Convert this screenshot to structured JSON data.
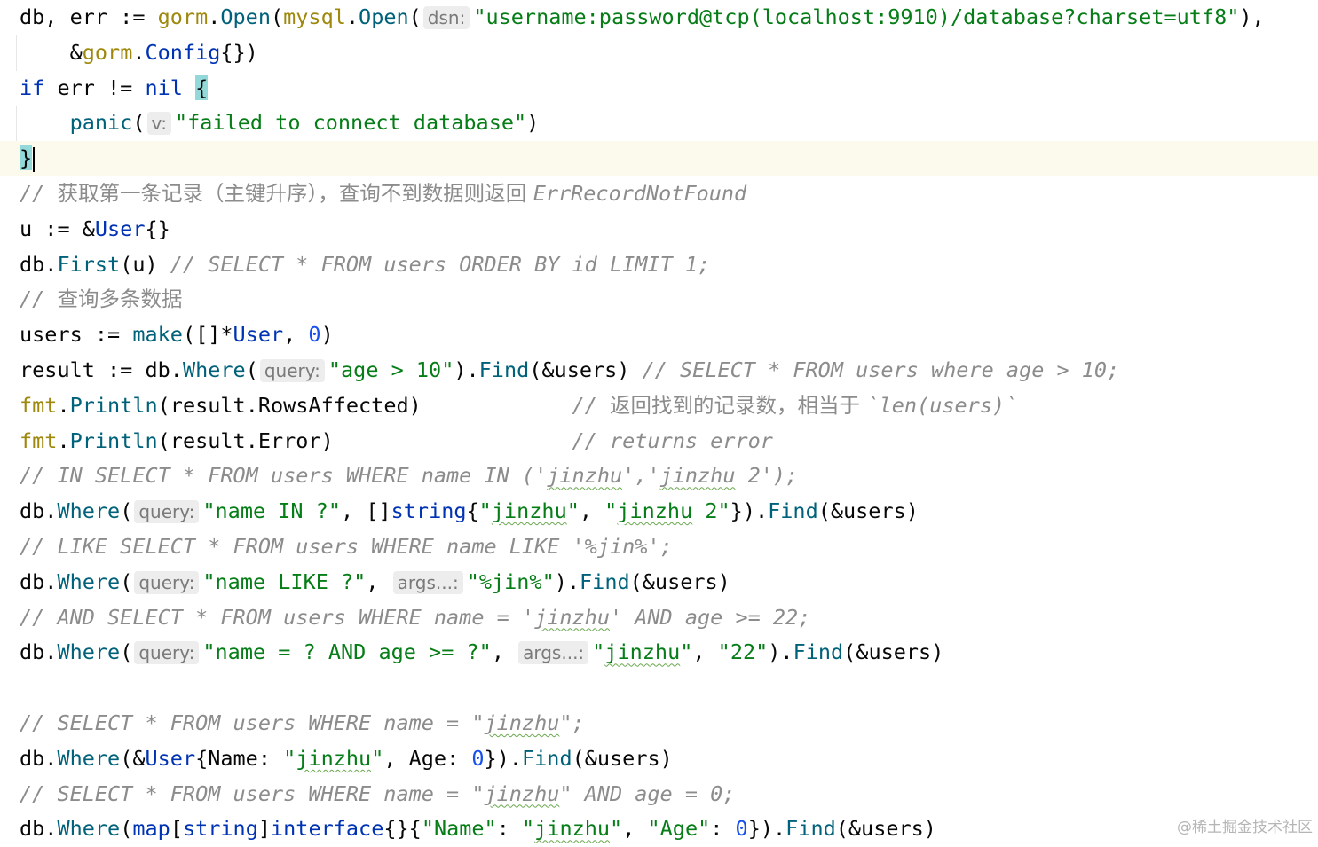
{
  "colors": {
    "background": "#ffffff",
    "current_line": "#fcfaed",
    "keyword": "#0033b3",
    "package": "#9e880d",
    "function": "#00627a",
    "string": "#067d17",
    "number": "#1750eb",
    "comment": "#8c8c8c",
    "hint_bg": "#ededed",
    "brace_highlight": "#93d9d9"
  },
  "editor": {
    "current_line_index": 4,
    "lines": [
      [
        {
          "t": "plain",
          "v": "db, err := "
        },
        {
          "t": "pkg",
          "v": "gorm"
        },
        {
          "t": "plain",
          "v": "."
        },
        {
          "t": "fn",
          "v": "Open"
        },
        {
          "t": "plain",
          "v": "("
        },
        {
          "t": "pkg",
          "v": "mysql"
        },
        {
          "t": "plain",
          "v": "."
        },
        {
          "t": "fn",
          "v": "Open"
        },
        {
          "t": "plain",
          "v": "("
        },
        {
          "t": "hint",
          "v": "dsn:"
        },
        {
          "t": "str",
          "v": "\"username:password@tcp(localhost:9910)/database?charset=utf8\""
        },
        {
          "t": "plain",
          "v": "),"
        }
      ],
      [
        {
          "t": "plain",
          "v": "    &"
        },
        {
          "t": "pkg",
          "v": "gorm"
        },
        {
          "t": "plain",
          "v": "."
        },
        {
          "t": "type",
          "v": "Config"
        },
        {
          "t": "plain",
          "v": "{})"
        }
      ],
      [
        {
          "t": "kw",
          "v": "if"
        },
        {
          "t": "plain",
          "v": " err != "
        },
        {
          "t": "kw",
          "v": "nil"
        },
        {
          "t": "plain",
          "v": " "
        },
        {
          "t": "brace",
          "v": "{"
        }
      ],
      [
        {
          "t": "plain",
          "v": "    "
        },
        {
          "t": "fn",
          "v": "panic"
        },
        {
          "t": "plain",
          "v": "("
        },
        {
          "t": "hint",
          "v": "v:"
        },
        {
          "t": "str",
          "v": "\"failed to connect database\""
        },
        {
          "t": "plain",
          "v": ")"
        }
      ],
      [
        {
          "t": "brace",
          "v": "}"
        },
        {
          "t": "caret",
          "v": ""
        }
      ],
      [
        {
          "t": "comment",
          "v": "// "
        },
        {
          "t": "comment-cn",
          "v": "获取第一条记录（主键升序），查询不到数据则返回 "
        },
        {
          "t": "comment",
          "v": "ErrRecordNotFound"
        }
      ],
      [
        {
          "t": "plain",
          "v": "u := &"
        },
        {
          "t": "type",
          "v": "User"
        },
        {
          "t": "plain",
          "v": "{}"
        }
      ],
      [
        {
          "t": "plain",
          "v": "db."
        },
        {
          "t": "fn",
          "v": "First"
        },
        {
          "t": "plain",
          "v": "(u) "
        },
        {
          "t": "comment",
          "v": "// SELECT * FROM users ORDER BY id LIMIT 1;"
        }
      ],
      [
        {
          "t": "comment",
          "v": "// "
        },
        {
          "t": "comment-cn",
          "v": "查询多条数据"
        }
      ],
      [
        {
          "t": "plain",
          "v": "users := "
        },
        {
          "t": "fn",
          "v": "make"
        },
        {
          "t": "plain",
          "v": "([]*"
        },
        {
          "t": "type",
          "v": "User"
        },
        {
          "t": "plain",
          "v": ", "
        },
        {
          "t": "num",
          "v": "0"
        },
        {
          "t": "plain",
          "v": ")"
        }
      ],
      [
        {
          "t": "plain",
          "v": "result := db."
        },
        {
          "t": "fn",
          "v": "Where"
        },
        {
          "t": "plain",
          "v": "("
        },
        {
          "t": "hint",
          "v": "query:"
        },
        {
          "t": "str",
          "v": "\"age > 10\""
        },
        {
          "t": "plain",
          "v": ")."
        },
        {
          "t": "fn",
          "v": "Find"
        },
        {
          "t": "plain",
          "v": "(&users) "
        },
        {
          "t": "comment",
          "v": "// SELECT * FROM users where age > 10;"
        }
      ],
      [
        {
          "t": "pkg",
          "v": "fmt"
        },
        {
          "t": "plain",
          "v": "."
        },
        {
          "t": "fn",
          "v": "Println"
        },
        {
          "t": "plain",
          "v": "(result.RowsAffected)            "
        },
        {
          "t": "comment",
          "v": "// "
        },
        {
          "t": "comment-cn",
          "v": "返回找到的记录数，相当于 "
        },
        {
          "t": "comment",
          "v": "`len(users)`"
        }
      ],
      [
        {
          "t": "pkg",
          "v": "fmt"
        },
        {
          "t": "plain",
          "v": "."
        },
        {
          "t": "fn",
          "v": "Println"
        },
        {
          "t": "plain",
          "v": "(result.Error)                   "
        },
        {
          "t": "comment",
          "v": "// returns error"
        }
      ],
      [
        {
          "t": "comment",
          "v": "// IN SELECT * FROM users WHERE name IN ('"
        },
        {
          "t": "comment-sq",
          "v": "jinzhu"
        },
        {
          "t": "comment",
          "v": "','"
        },
        {
          "t": "comment-sq",
          "v": "jinzhu"
        },
        {
          "t": "comment",
          "v": " 2');"
        }
      ],
      [
        {
          "t": "plain",
          "v": "db."
        },
        {
          "t": "fn",
          "v": "Where"
        },
        {
          "t": "plain",
          "v": "("
        },
        {
          "t": "hint",
          "v": "query:"
        },
        {
          "t": "str",
          "v": "\"name IN ?\""
        },
        {
          "t": "plain",
          "v": ", []"
        },
        {
          "t": "kw",
          "v": "string"
        },
        {
          "t": "plain",
          "v": "{"
        },
        {
          "t": "str",
          "v": "\""
        },
        {
          "t": "str-sq",
          "v": "jinzhu"
        },
        {
          "t": "str",
          "v": "\""
        },
        {
          "t": "plain",
          "v": ", "
        },
        {
          "t": "str",
          "v": "\""
        },
        {
          "t": "str-sq",
          "v": "jinzhu"
        },
        {
          "t": "str",
          "v": " 2\""
        },
        {
          "t": "plain",
          "v": "})."
        },
        {
          "t": "fn",
          "v": "Find"
        },
        {
          "t": "plain",
          "v": "(&users)"
        }
      ],
      [
        {
          "t": "comment",
          "v": "// LIKE SELECT * FROM users WHERE name LIKE '%jin%';"
        }
      ],
      [
        {
          "t": "plain",
          "v": "db."
        },
        {
          "t": "fn",
          "v": "Where"
        },
        {
          "t": "plain",
          "v": "("
        },
        {
          "t": "hint",
          "v": "query:"
        },
        {
          "t": "str",
          "v": "\"name LIKE ?\""
        },
        {
          "t": "plain",
          "v": ", "
        },
        {
          "t": "hint",
          "v": "args...:"
        },
        {
          "t": "str",
          "v": "\"%jin%\""
        },
        {
          "t": "plain",
          "v": ")."
        },
        {
          "t": "fn",
          "v": "Find"
        },
        {
          "t": "plain",
          "v": "(&users)"
        }
      ],
      [
        {
          "t": "comment",
          "v": "// AND SELECT * FROM users WHERE name = '"
        },
        {
          "t": "comment-sq",
          "v": "jinzhu"
        },
        {
          "t": "comment",
          "v": "' AND age >= 22;"
        }
      ],
      [
        {
          "t": "plain",
          "v": "db."
        },
        {
          "t": "fn",
          "v": "Where"
        },
        {
          "t": "plain",
          "v": "("
        },
        {
          "t": "hint",
          "v": "query:"
        },
        {
          "t": "str",
          "v": "\"name = ? AND age >= ?\""
        },
        {
          "t": "plain",
          "v": ", "
        },
        {
          "t": "hint",
          "v": "args...:"
        },
        {
          "t": "str",
          "v": "\""
        },
        {
          "t": "str-sq",
          "v": "jinzhu"
        },
        {
          "t": "str",
          "v": "\""
        },
        {
          "t": "plain",
          "v": ", "
        },
        {
          "t": "str",
          "v": "\"22\""
        },
        {
          "t": "plain",
          "v": ")."
        },
        {
          "t": "fn",
          "v": "Find"
        },
        {
          "t": "plain",
          "v": "(&users)"
        }
      ],
      [],
      [
        {
          "t": "comment",
          "v": "// SELECT * FROM users WHERE name = \""
        },
        {
          "t": "comment-sq",
          "v": "jinzhu"
        },
        {
          "t": "comment",
          "v": "\";"
        }
      ],
      [
        {
          "t": "plain",
          "v": "db."
        },
        {
          "t": "fn",
          "v": "Where"
        },
        {
          "t": "plain",
          "v": "(&"
        },
        {
          "t": "type",
          "v": "User"
        },
        {
          "t": "plain",
          "v": "{Name: "
        },
        {
          "t": "str",
          "v": "\""
        },
        {
          "t": "str-sq",
          "v": "jinzhu"
        },
        {
          "t": "str",
          "v": "\""
        },
        {
          "t": "plain",
          "v": ", Age: "
        },
        {
          "t": "num",
          "v": "0"
        },
        {
          "t": "plain",
          "v": "})."
        },
        {
          "t": "fn",
          "v": "Find"
        },
        {
          "t": "plain",
          "v": "(&users)"
        }
      ],
      [
        {
          "t": "comment",
          "v": "// SELECT * FROM users WHERE name = \""
        },
        {
          "t": "comment-sq",
          "v": "jinzhu"
        },
        {
          "t": "comment",
          "v": "\" AND age = 0;"
        }
      ],
      [
        {
          "t": "plain",
          "v": "db."
        },
        {
          "t": "fn",
          "v": "Where"
        },
        {
          "t": "plain",
          "v": "("
        },
        {
          "t": "kw",
          "v": "map"
        },
        {
          "t": "plain",
          "v": "["
        },
        {
          "t": "kw",
          "v": "string"
        },
        {
          "t": "plain",
          "v": "]"
        },
        {
          "t": "kw",
          "v": "interface"
        },
        {
          "t": "plain",
          "v": "{}{"
        },
        {
          "t": "str",
          "v": "\"Name\""
        },
        {
          "t": "plain",
          "v": ": "
        },
        {
          "t": "str",
          "v": "\""
        },
        {
          "t": "str-sq",
          "v": "jinzhu"
        },
        {
          "t": "str",
          "v": "\""
        },
        {
          "t": "plain",
          "v": ", "
        },
        {
          "t": "str",
          "v": "\"Age\""
        },
        {
          "t": "plain",
          "v": ": "
        },
        {
          "t": "num",
          "v": "0"
        },
        {
          "t": "plain",
          "v": "})."
        },
        {
          "t": "fn",
          "v": "Find"
        },
        {
          "t": "plain",
          "v": "(&users)"
        }
      ]
    ]
  },
  "watermark": {
    "text": "@稀土掘金技术社区"
  }
}
